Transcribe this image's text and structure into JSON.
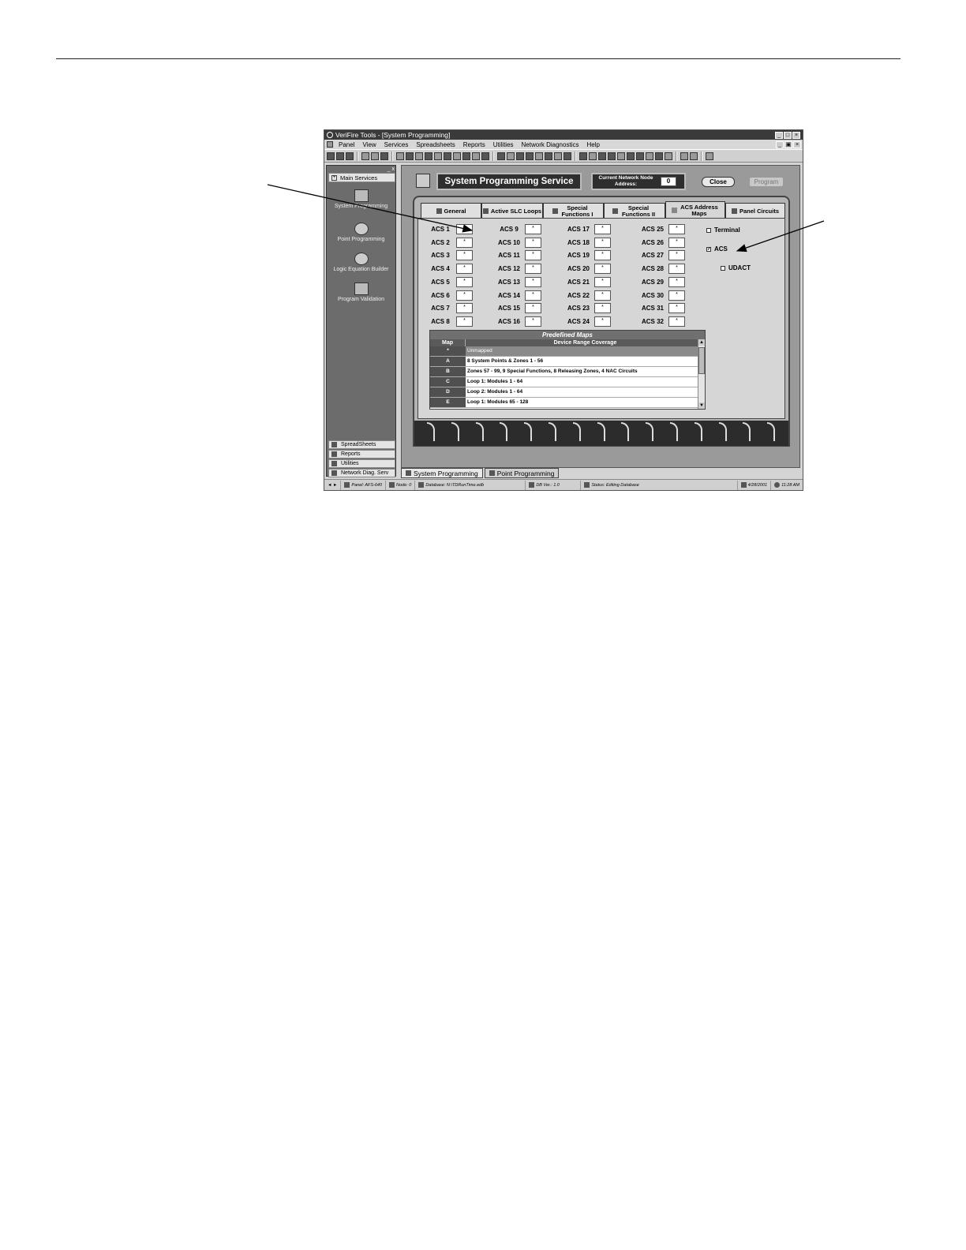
{
  "window": {
    "title": "VeriFire Tools - [System Programming]",
    "controls": [
      "_",
      "□",
      "×"
    ],
    "child_controls": [
      "_",
      "▣",
      "×"
    ]
  },
  "menu": [
    "Panel",
    "View",
    "Services",
    "Spreadsheets",
    "Reports",
    "Utilities",
    "Network Diagnostics",
    "Help"
  ],
  "sidebar": {
    "header": "Main Services",
    "items": [
      {
        "label": "System Programming",
        "icon": "system-programming-icon"
      },
      {
        "label": "Point Programming",
        "icon": "point-programming-icon"
      },
      {
        "label": "Logic Equation Builder",
        "icon": "logic-builder-icon"
      },
      {
        "label": "Program Validation",
        "icon": "validation-icon"
      }
    ],
    "bottom": [
      "SpreadSheets",
      "Reports",
      "Utilities",
      "Network Diag. Serv"
    ]
  },
  "header": {
    "title": "System Programming Service",
    "node_label": "Current Network Node Address:",
    "node_value": "0",
    "close": "Close",
    "program": "Program"
  },
  "tabs": [
    {
      "label": "General"
    },
    {
      "label": "Active SLC Loops"
    },
    {
      "label": "Special Functions I"
    },
    {
      "label": "Special Functions II"
    },
    {
      "label": "ACS Address Maps",
      "active": true
    },
    {
      "label": "Panel Circuits"
    }
  ],
  "acs": {
    "col1": [
      {
        "label": "ACS 1",
        "value": "*"
      },
      {
        "label": "ACS 2",
        "value": "*"
      },
      {
        "label": "ACS 3",
        "value": "*"
      },
      {
        "label": "ACS 4",
        "value": "*"
      },
      {
        "label": "ACS 5",
        "value": "*"
      },
      {
        "label": "ACS 6",
        "value": "*"
      },
      {
        "label": "ACS 7",
        "value": "*"
      },
      {
        "label": "ACS 8",
        "value": "*"
      }
    ],
    "col2": [
      {
        "label": "ACS 9",
        "value": "*"
      },
      {
        "label": "ACS 10",
        "value": "*"
      },
      {
        "label": "ACS 11",
        "value": "*"
      },
      {
        "label": "ACS 12",
        "value": "*"
      },
      {
        "label": "ACS 13",
        "value": "*"
      },
      {
        "label": "ACS 14",
        "value": "*"
      },
      {
        "label": "ACS 15",
        "value": "*"
      },
      {
        "label": "ACS 16",
        "value": "*"
      }
    ],
    "col3": [
      {
        "label": "ACS 17",
        "value": "*"
      },
      {
        "label": "ACS 18",
        "value": "*"
      },
      {
        "label": "ACS 19",
        "value": "*"
      },
      {
        "label": "ACS 20",
        "value": "*"
      },
      {
        "label": "ACS 21",
        "value": "*"
      },
      {
        "label": "ACS 22",
        "value": "*"
      },
      {
        "label": "ACS 23",
        "value": "*"
      },
      {
        "label": "ACS 24",
        "value": "*"
      }
    ],
    "col4": [
      {
        "label": "ACS 25",
        "value": "*"
      },
      {
        "label": "ACS 26",
        "value": "*"
      },
      {
        "label": "ACS 27",
        "value": "*"
      },
      {
        "label": "ACS 28",
        "value": "*"
      },
      {
        "label": "ACS 29",
        "value": "*"
      },
      {
        "label": "ACS 30",
        "value": "*"
      },
      {
        "label": "ACS 31",
        "value": "*"
      },
      {
        "label": "ACS 32",
        "value": "*"
      }
    ]
  },
  "options": {
    "terminal": {
      "label": "Terminal",
      "checked": false
    },
    "acs": {
      "label": "ACS",
      "checked": true
    },
    "udact": {
      "label": "UDACT",
      "checked": false
    }
  },
  "maps": {
    "title": "Predefined Maps",
    "headers": [
      "Map",
      "Device Range Coverage"
    ],
    "rows": [
      {
        "map": "*",
        "coverage": "Unmapped"
      },
      {
        "map": "A",
        "coverage": "8 System Points & Zones 1 - 56"
      },
      {
        "map": "B",
        "coverage": "Zones 57 - 99, 9 Special Functions, 8 Releasing Zones, 4 NAC Circuits"
      },
      {
        "map": "C",
        "coverage": "Loop 1: Modules 1 - 64"
      },
      {
        "map": "D",
        "coverage": "Loop 2: Modules 1 - 64"
      },
      {
        "map": "E",
        "coverage": "Loop 1: Modules 65 - 128"
      }
    ]
  },
  "doc_tabs": [
    "System Programming",
    "Point Programming"
  ],
  "status": {
    "panel": "Panel: AFS-640",
    "node": "Node: 0",
    "database": "Database: N:\\TDRunTime.edb",
    "db_ver": "DB Ver.: 1.0",
    "state": "Status: Editing Database",
    "date": "4/28/2001",
    "time": "11:28 AM"
  }
}
